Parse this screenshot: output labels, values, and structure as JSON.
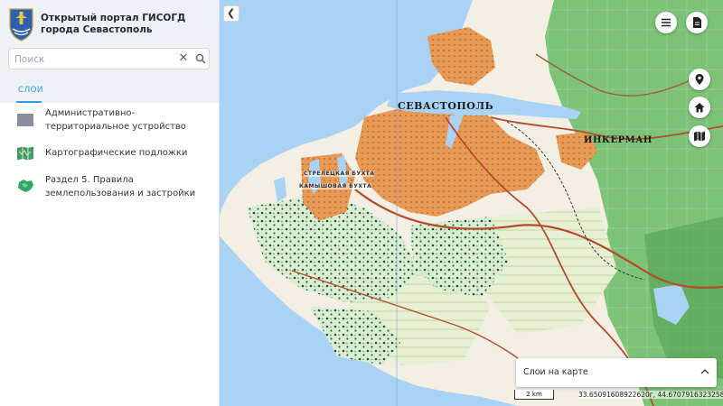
{
  "header": {
    "title": "Открытый портал ГИСОГД города Севастополь"
  },
  "search": {
    "placeholder": "Поиск",
    "value": ""
  },
  "tabs": [
    {
      "label": "СЛОИ",
      "active": true
    }
  ],
  "layers": [
    {
      "label": "Административно-территориальное устройство",
      "icon": "admin-boundary-icon"
    },
    {
      "label": "Картографические подложки",
      "icon": "basemap-icon"
    },
    {
      "label": "Раздел 5. Правила землепользования и застройки",
      "icon": "zoning-map-icon"
    }
  ],
  "map": {
    "labels": {
      "city": "СЕВАСТОПОЛЬ",
      "inkerman": "ИНКЕРМАН",
      "streletskaya": "СТРЕЛЕЦКАЯ БУХТА",
      "kamyshovaya": "КАМЫШОВАЯ БУХТА"
    },
    "scale": "2 km",
    "coordinates": "33.65091608922620г, 44.67079163232589",
    "layers_panel_title": "Слои на карте"
  },
  "colors": {
    "accent": "#2b9af3",
    "sea": "#a9d3f5",
    "urban": "#e89a52",
    "forest": "#5fae5b",
    "land": "#f3efe4"
  },
  "icons": {
    "collapse": "chevron-left-icon",
    "menu": "hamburger-menu-icon",
    "document": "document-icon",
    "location": "location-pin-icon",
    "home": "home-icon",
    "map": "map-icon"
  }
}
